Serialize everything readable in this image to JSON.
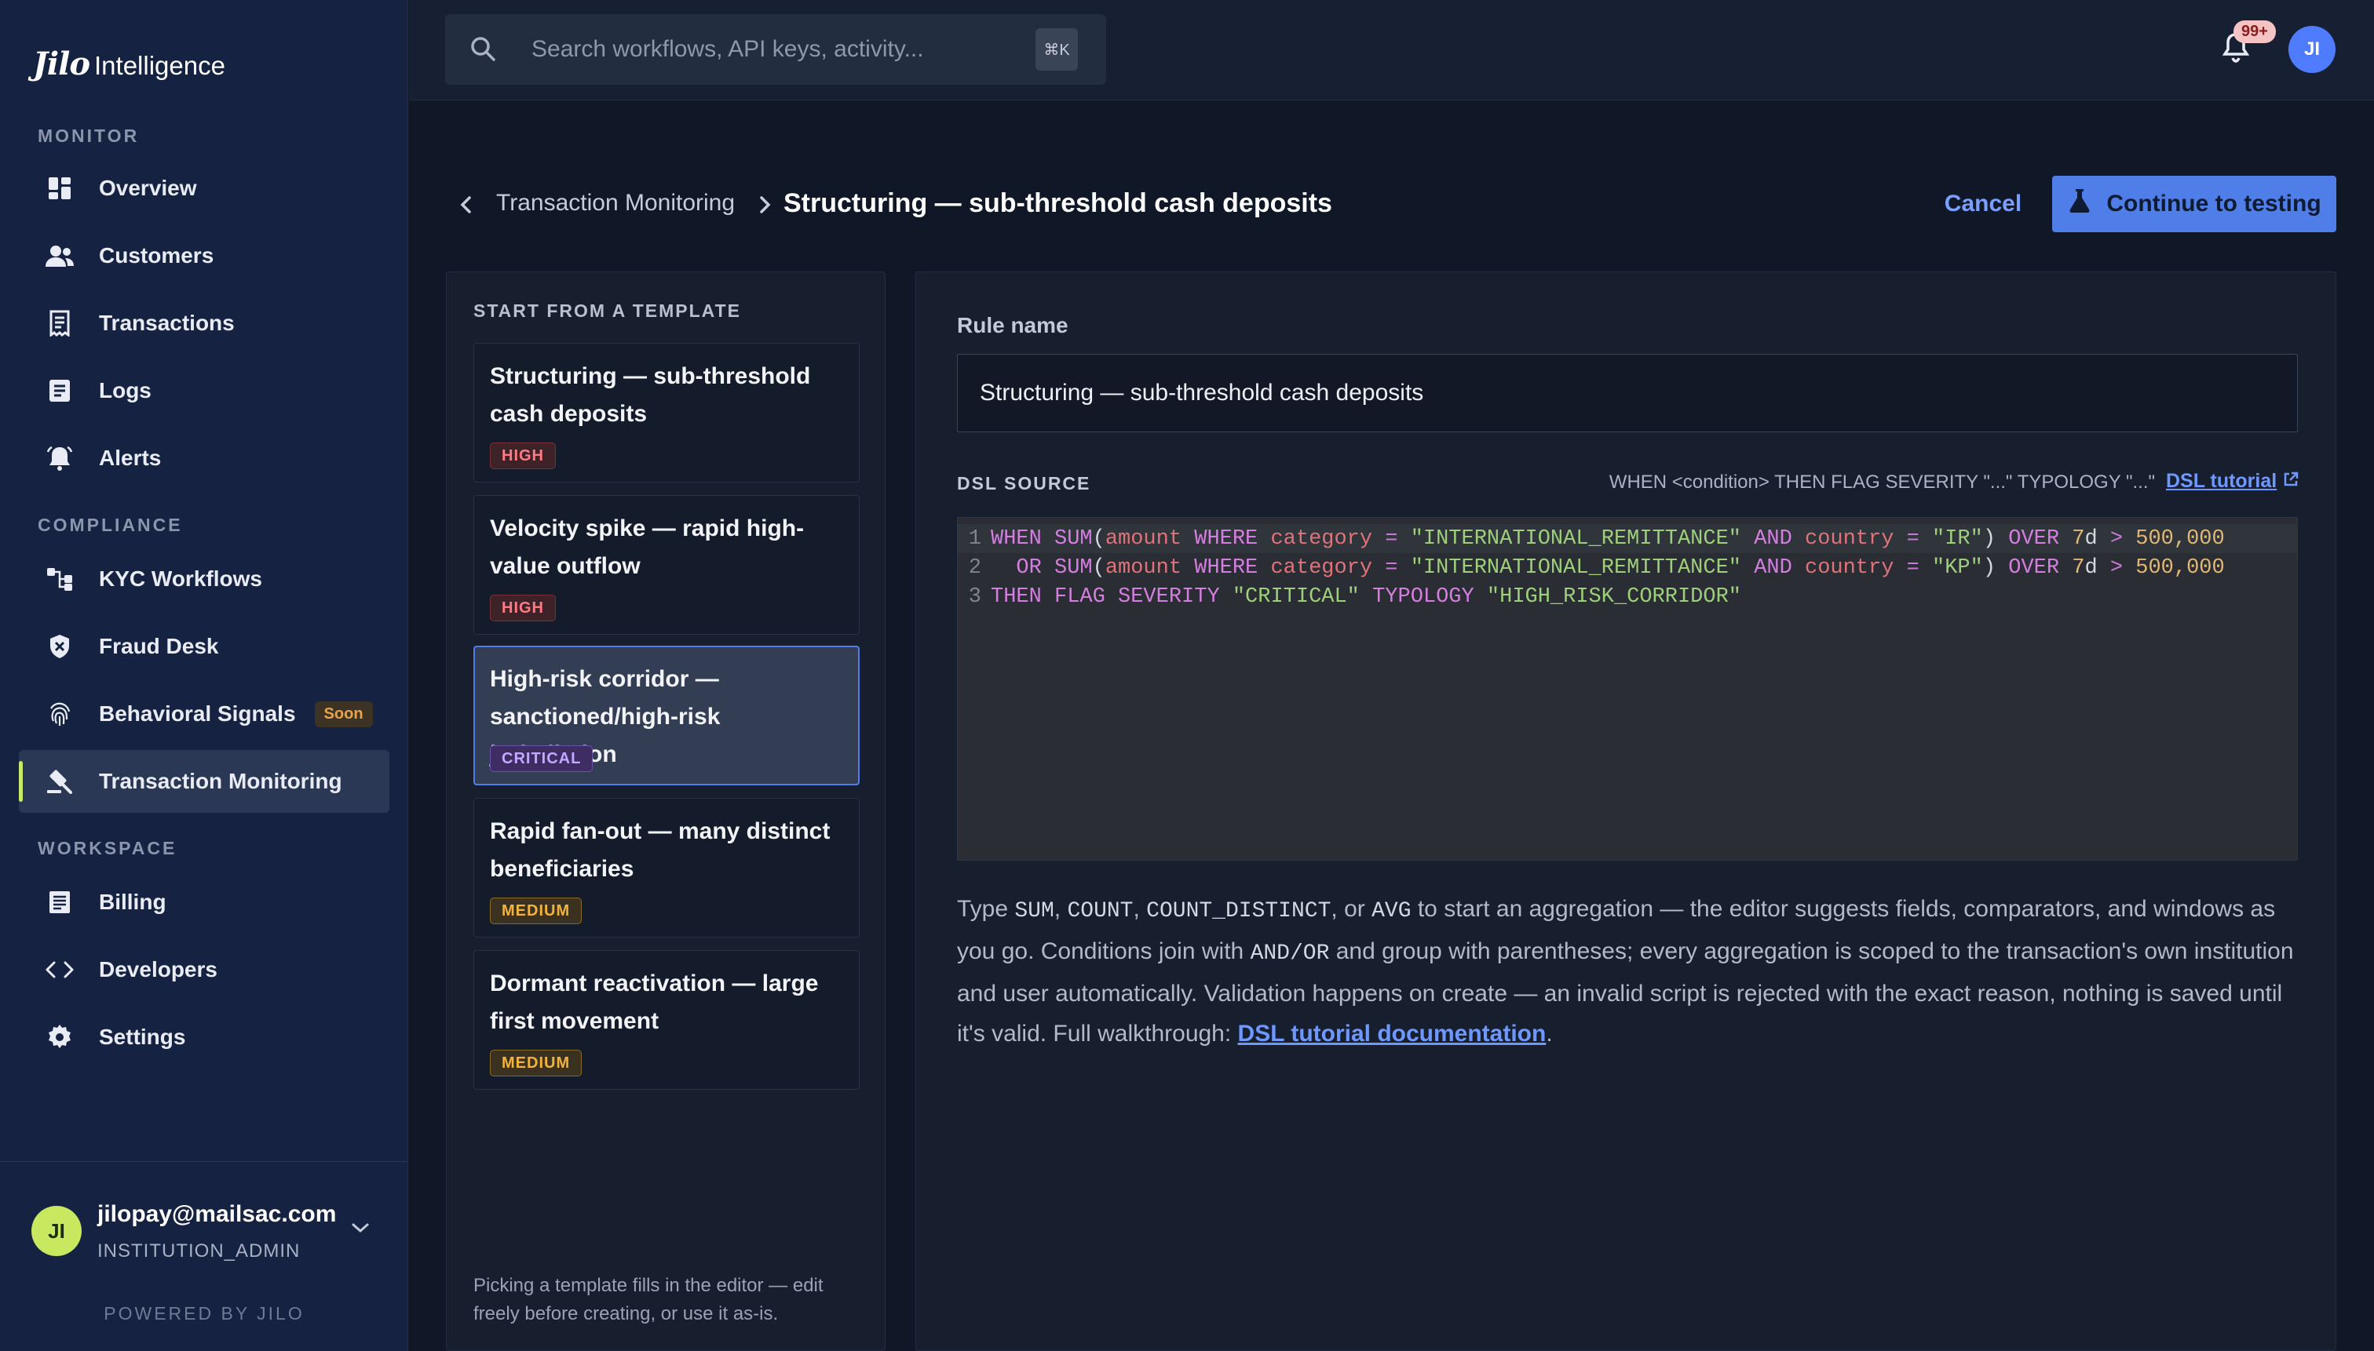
{
  "app": {
    "logo_text": "Jilo",
    "brand_suffix": "Intelligence"
  },
  "sidebar": {
    "sections": [
      {
        "label": "MONITOR"
      },
      {
        "label": "COMPLIANCE"
      },
      {
        "label": "WORKSPACE"
      }
    ],
    "items": [
      {
        "label": "Overview",
        "icon": "dashboard-icon"
      },
      {
        "label": "Customers",
        "icon": "users-icon"
      },
      {
        "label": "Transactions",
        "icon": "receipt-icon"
      },
      {
        "label": "Logs",
        "icon": "document-icon"
      },
      {
        "label": "Alerts",
        "icon": "bell-ring-icon"
      },
      {
        "label": "KYC Workflows",
        "icon": "workflow-icon"
      },
      {
        "label": "Fraud Desk",
        "icon": "shield-icon"
      },
      {
        "label": "Behavioral Signals",
        "icon": "fingerprint-icon",
        "badge": "Soon"
      },
      {
        "label": "Transaction Monitoring",
        "icon": "gavel-icon",
        "active": true
      },
      {
        "label": "Billing",
        "icon": "invoice-icon"
      },
      {
        "label": "Developers",
        "icon": "code-icon"
      },
      {
        "label": "Settings",
        "icon": "gear-icon"
      }
    ],
    "user": {
      "initials": "JI",
      "email": "jilopay@mailsac.com",
      "role": "INSTITUTION_ADMIN"
    },
    "powered_by": "POWERED BY JILO"
  },
  "topbar": {
    "search_placeholder": "Search workflows, API keys, activity...",
    "shortcut": "⌘K",
    "notifications_badge": "99+",
    "avatar_initials": "JI"
  },
  "header": {
    "breadcrumb_parent": "Transaction Monitoring",
    "title": "Structuring — sub-threshold cash deposits",
    "cancel_label": "Cancel",
    "primary_label": "Continue to testing"
  },
  "templates": {
    "heading": "START FROM A TEMPLATE",
    "items": [
      {
        "title": "Structuring — sub-threshold cash deposits",
        "severity": "HIGH"
      },
      {
        "title": "Velocity spike — rapid high-value outflow",
        "severity": "HIGH"
      },
      {
        "title": "High-risk corridor — sanctioned/high-risk jurisdiction",
        "severity": "CRITICAL",
        "selected": true
      },
      {
        "title": "Rapid fan-out — many distinct beneficiaries",
        "severity": "MEDIUM"
      },
      {
        "title": "Dormant reactivation — large first movement",
        "severity": "MEDIUM"
      }
    ],
    "footer_note": "Picking a template fills in the editor — edit freely before creating, or use it as-is."
  },
  "editor": {
    "rule_name_label": "Rule name",
    "rule_name_value": "Structuring — sub-threshold cash deposits",
    "dsl_label": "DSL SOURCE",
    "dsl_hint": "WHEN <condition> THEN FLAG SEVERITY \"...\" TYPOLOGY \"...\"",
    "dsl_tutorial_label": "DSL tutorial",
    "code_lines": [
      "WHEN SUM(amount WHERE category = \"INTERNATIONAL_REMITTANCE\" AND country = \"IR\") OVER 7d > 500,000",
      "  OR SUM(amount WHERE category = \"INTERNATIONAL_REMITTANCE\" AND country = \"KP\") OVER 7d > 500,000",
      "THEN FLAG SEVERITY \"CRITICAL\" TYPOLOGY \"HIGH_RISK_CORRIDOR\""
    ],
    "help": {
      "p1": "Type ",
      "sum": "SUM",
      "c1": ", ",
      "count": "COUNT",
      "c2": ", ",
      "count_distinct": "COUNT_DISTINCT",
      "c3": ", or ",
      "avg": "AVG",
      "p2": " to start an aggregation — the editor suggests fields, comparators, and windows as you go. Conditions join with ",
      "andor": "AND/OR",
      "p3": " and group with parentheses; every aggregation is scoped to the transaction's own institution and user automatically. Validation happens on create — an invalid script is rejected with the exact reason, nothing is saved until it's valid. Full walkthrough: ",
      "link": "DSL tutorial documentation",
      "end": "."
    }
  },
  "colors": {
    "accent_blue": "#4f7ee8",
    "active_marker": "#c9e86a",
    "sidebar_bg": "#152241",
    "severity_high": "#ff7a85",
    "severity_critical": "#c4a8ff",
    "severity_medium": "#f2b33d"
  }
}
